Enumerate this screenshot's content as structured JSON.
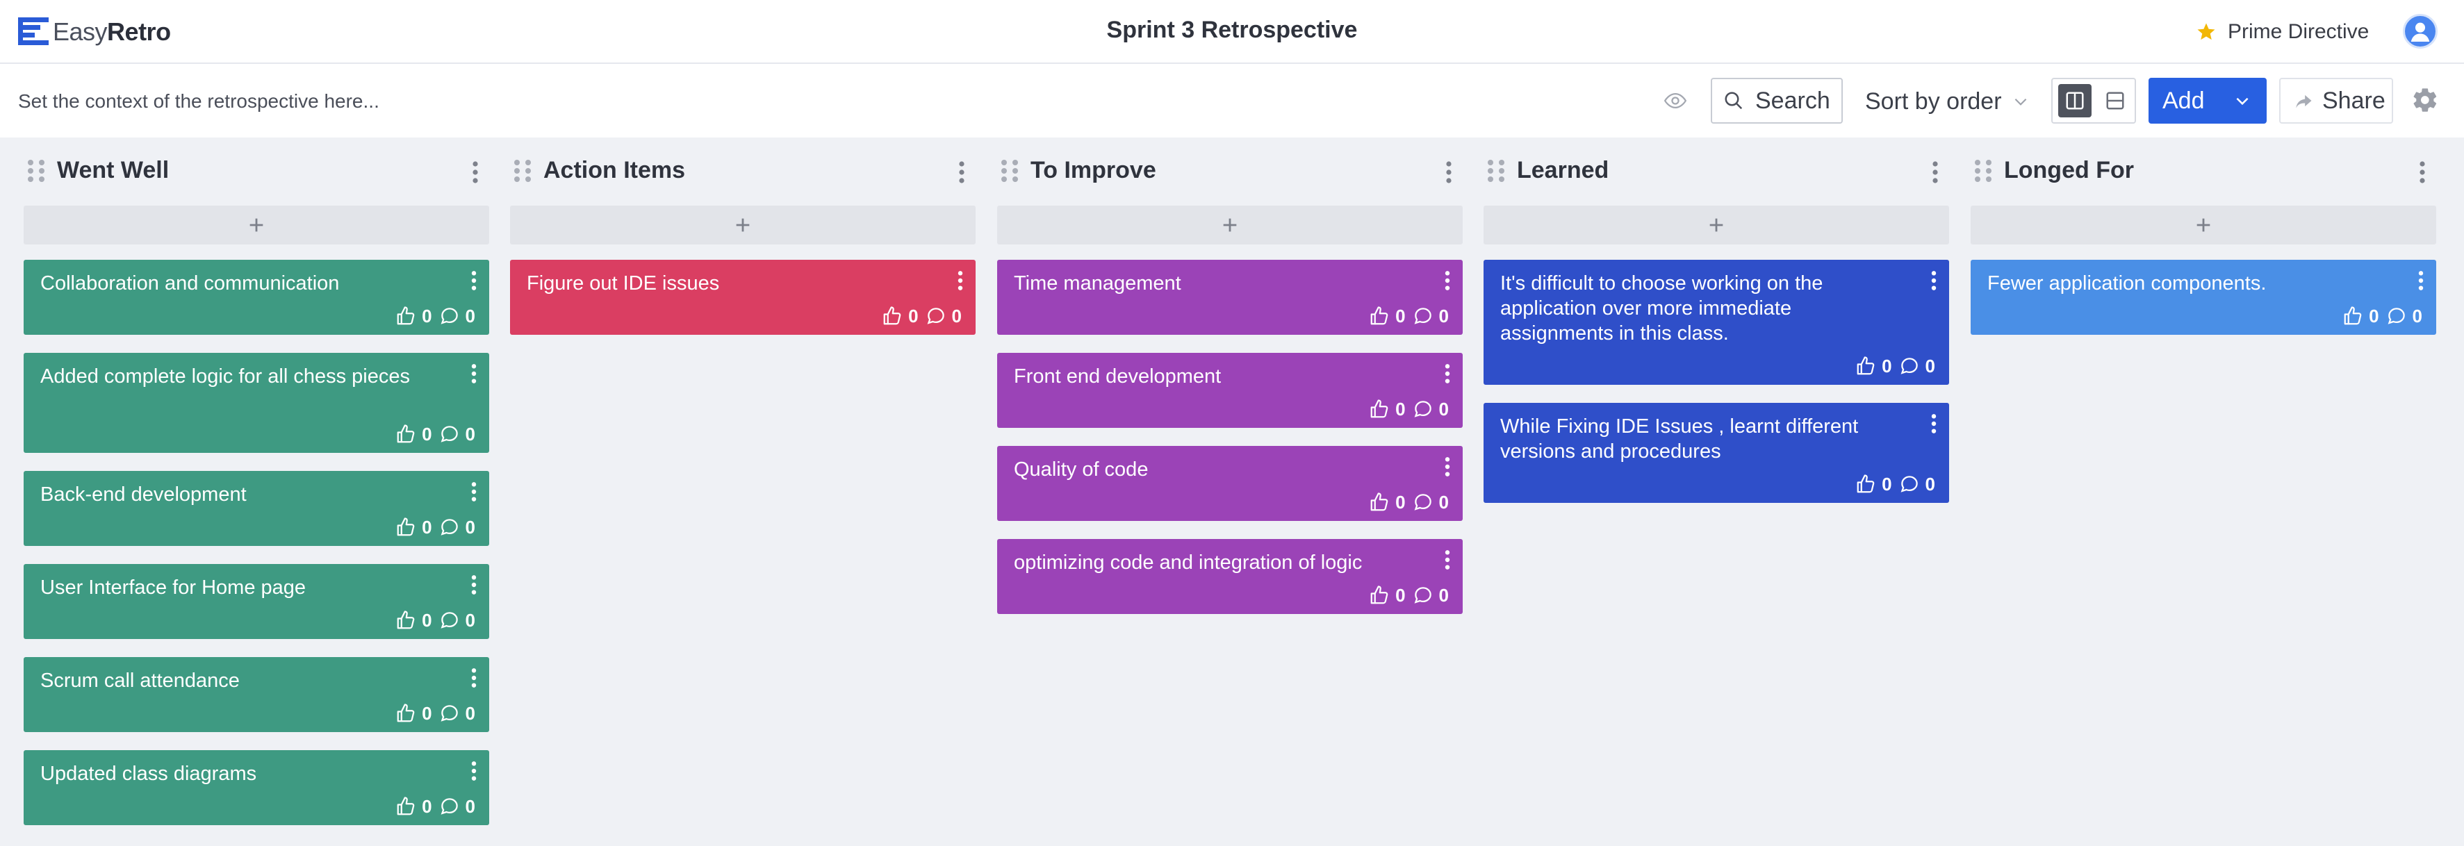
{
  "app": {
    "logo_easy": "Easy",
    "logo_retro": "Retro",
    "board_title": "Sprint 3 Retrospective",
    "prime_directive": "Prime Directive"
  },
  "toolbar": {
    "context_placeholder": "Set the context of the retrospective here...",
    "search_label": "Search",
    "sort_label": "Sort by order",
    "add_label": "Add",
    "share_label": "Share"
  },
  "colors": {
    "went_well": "#3e9a82",
    "action_items": "#da3e62",
    "to_improve": "#9b43b7",
    "learned": "#2f4fc9",
    "longed_for": "#4a8fe6",
    "accent": "#2860e1"
  },
  "columns": [
    {
      "title": "Went Well",
      "color": "#3e9a82",
      "cards": [
        {
          "text": "Collaboration and communication",
          "likes": "0",
          "comments": "0"
        },
        {
          "text": "Added complete logic for all chess pieces",
          "likes": "0",
          "comments": "0"
        },
        {
          "text": "Back-end development",
          "likes": "0",
          "comments": "0"
        },
        {
          "text": "User Interface for Home page",
          "likes": "0",
          "comments": "0"
        },
        {
          "text": "Scrum call attendance",
          "likes": "0",
          "comments": "0"
        },
        {
          "text": "Updated class diagrams",
          "likes": "0",
          "comments": "0"
        }
      ]
    },
    {
      "title": "Action Items",
      "color": "#da3e62",
      "cards": [
        {
          "text": "Figure out IDE issues",
          "likes": "0",
          "comments": "0"
        }
      ]
    },
    {
      "title": "To Improve",
      "color": "#9b43b7",
      "cards": [
        {
          "text": "Time management",
          "likes": "0",
          "comments": "0"
        },
        {
          "text": "Front end development",
          "likes": "0",
          "comments": "0"
        },
        {
          "text": "Quality of code",
          "likes": "0",
          "comments": "0"
        },
        {
          "text": "optimizing code and integration of logic",
          "likes": "0",
          "comments": "0"
        }
      ]
    },
    {
      "title": "Learned",
      "color": "#2f4fc9",
      "cards": [
        {
          "text": "It's difficult to choose working on the application over more immediate assignments in this class.",
          "likes": "0",
          "comments": "0"
        },
        {
          "text": "While Fixing IDE Issues , learnt different versions and procedures",
          "likes": "0",
          "comments": "0"
        }
      ]
    },
    {
      "title": "Longed For",
      "color": "#4a8fe6",
      "cards": [
        {
          "text": "Fewer application components.",
          "likes": "0",
          "comments": "0"
        }
      ]
    }
  ]
}
